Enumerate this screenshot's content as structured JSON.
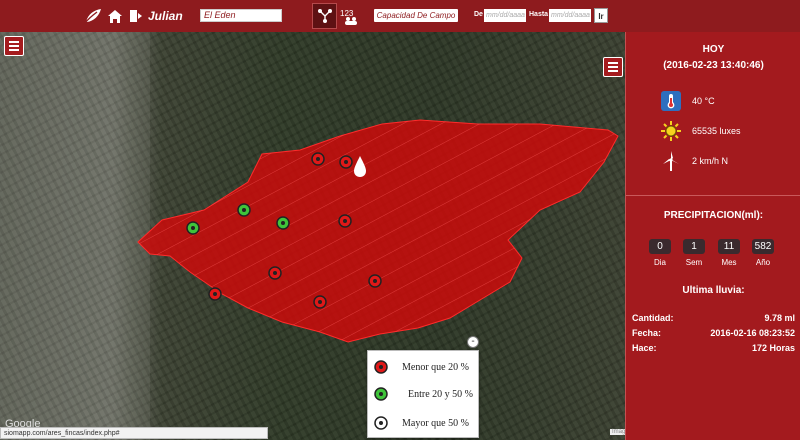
{
  "header": {
    "username": "Julian",
    "farm_name": "El Eden",
    "capacity_button": "Capacidad De Campo",
    "from_label": "De",
    "to_label": "Hasta",
    "date_placeholder": "mm/dd/aaaa",
    "go_button": "Ir",
    "view_ranking_label": "123"
  },
  "map": {
    "status_url": "siomapp.com/ares_fincas/index.php#",
    "google_mark": "Google",
    "imagery_mark": "Imag",
    "legend_collapse": "-",
    "legend": [
      {
        "label": "Menor que 20 %",
        "color": "#e01818"
      },
      {
        "label": "Entre 20 y 50 %",
        "color": "#3fc43a"
      },
      {
        "label": "Mayor que 50 %",
        "color": "#ffffff"
      }
    ]
  },
  "panel": {
    "today": {
      "title": "HOY",
      "datetime": "(2016-02-23 13:40:46)",
      "temperature": "40 °C",
      "light": "65535 luxes",
      "wind": "2 km/h N"
    },
    "precipitation": {
      "title": "PRECIPITACION(ml):",
      "periods": [
        {
          "label": "Dia",
          "value": "0"
        },
        {
          "label": "Sem",
          "value": "1"
        },
        {
          "label": "Mes",
          "value": "11"
        },
        {
          "label": "Año",
          "value": "582"
        }
      ]
    },
    "last_rain": {
      "title": "Ultima lluvia:",
      "rows": [
        {
          "label": "Cantidad:",
          "value": "9.78 ml"
        },
        {
          "label": "Fecha:",
          "value": "2016-02-16 08:23:52"
        },
        {
          "label": "Hace:",
          "value": "172 Horas"
        }
      ]
    }
  },
  "colors": {
    "brand": "#8e1b1e",
    "panel": "#a31a1e",
    "field_overlay": "#cc0a0a"
  }
}
